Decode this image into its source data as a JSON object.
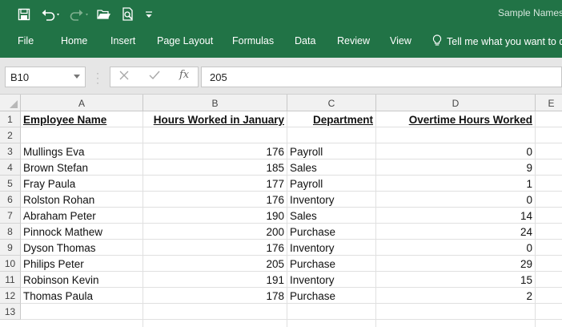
{
  "title_bar": {
    "doc_title": "Sample Names",
    "qat_icons": [
      "save-icon",
      "undo-icon",
      "redo-icon",
      "open-folder-icon",
      "print-preview-icon",
      "customize-qat-icon"
    ]
  },
  "ribbon": {
    "tabs": [
      "File",
      "Home",
      "Insert",
      "Page Layout",
      "Formulas",
      "Data",
      "Review",
      "View"
    ],
    "tell_me": "Tell me what you want to d"
  },
  "formula_bar": {
    "name_box": "B10",
    "fx_label": "fx",
    "value": "205"
  },
  "grid": {
    "columns": [
      "A",
      "B",
      "C",
      "D",
      "E"
    ],
    "rows": [
      "1",
      "2",
      "3",
      "4",
      "5",
      "6",
      "7",
      "8",
      "9",
      "10",
      "11",
      "12",
      "13"
    ],
    "headers": {
      "a": "Employee Name",
      "b": "Hours Worked in January",
      "c": "Department",
      "d": "Overtime Hours Worked"
    },
    "data": [
      {
        "name": "Mullings Eva",
        "hours": "176",
        "dept": "Payroll",
        "overtime": "0"
      },
      {
        "name": "Brown Stefan",
        "hours": "185",
        "dept": "Sales",
        "overtime": "9"
      },
      {
        "name": "Fray Paula",
        "hours": "177",
        "dept": "Payroll",
        "overtime": "1"
      },
      {
        "name": "Rolston Rohan",
        "hours": "176",
        "dept": "Inventory",
        "overtime": "0"
      },
      {
        "name": "Abraham Peter",
        "hours": "190",
        "dept": "Sales",
        "overtime": "14"
      },
      {
        "name": "Pinnock Mathew",
        "hours": "200",
        "dept": "Purchase",
        "overtime": "24"
      },
      {
        "name": "Dyson Thomas",
        "hours": "176",
        "dept": "Inventory",
        "overtime": "0"
      },
      {
        "name": "Philips Peter",
        "hours": "205",
        "dept": "Purchase",
        "overtime": "29"
      },
      {
        "name": "Robinson Kevin",
        "hours": "191",
        "dept": "Inventory",
        "overtime": "15"
      },
      {
        "name": "Thomas Paula",
        "hours": "178",
        "dept": "Purchase",
        "overtime": "2"
      }
    ]
  },
  "colors": {
    "excel_green": "#217346",
    "header_bg": "#f1f1f1",
    "gridline": "#e0e0e0"
  }
}
